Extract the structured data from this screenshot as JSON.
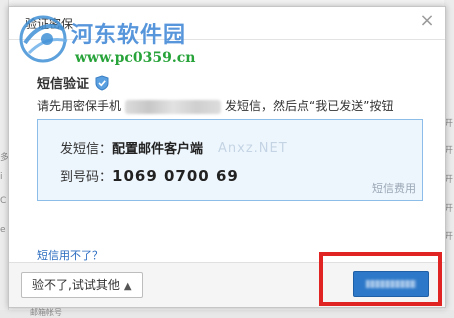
{
  "window": {
    "title": "验证密保"
  },
  "watermark": {
    "site_name": "河东软件园",
    "site_url": "www.pc0359.cn",
    "overlay_text": "Anxz.NET"
  },
  "verification": {
    "title": "短信验证",
    "instruction_prefix": "请先用密保手机",
    "instruction_suffix": "发短信，然后点“我已发送”按钮",
    "sms_label": "发短信：",
    "sms_content": "配置邮件客户端",
    "to_label": "到号码：",
    "to_number": "1069 0700 69",
    "fee_text": "短信费用"
  },
  "help": {
    "link_text": "短信用不了？"
  },
  "footer": {
    "other_button_label": "验不了,试试其他"
  },
  "background_fragments": {
    "right_chars": [
      "开",
      "开",
      "开",
      "开",
      "开"
    ],
    "left_chars": [
      "多",
      "i",
      "C",
      "e"
    ],
    "bottom_text": "邮箱帐号"
  },
  "colors": {
    "accent": "#2d78c8",
    "highlight": "#e02424",
    "box_bg": "#eef6fd",
    "box_border": "#8cbde8",
    "link": "#2b6cc0"
  }
}
